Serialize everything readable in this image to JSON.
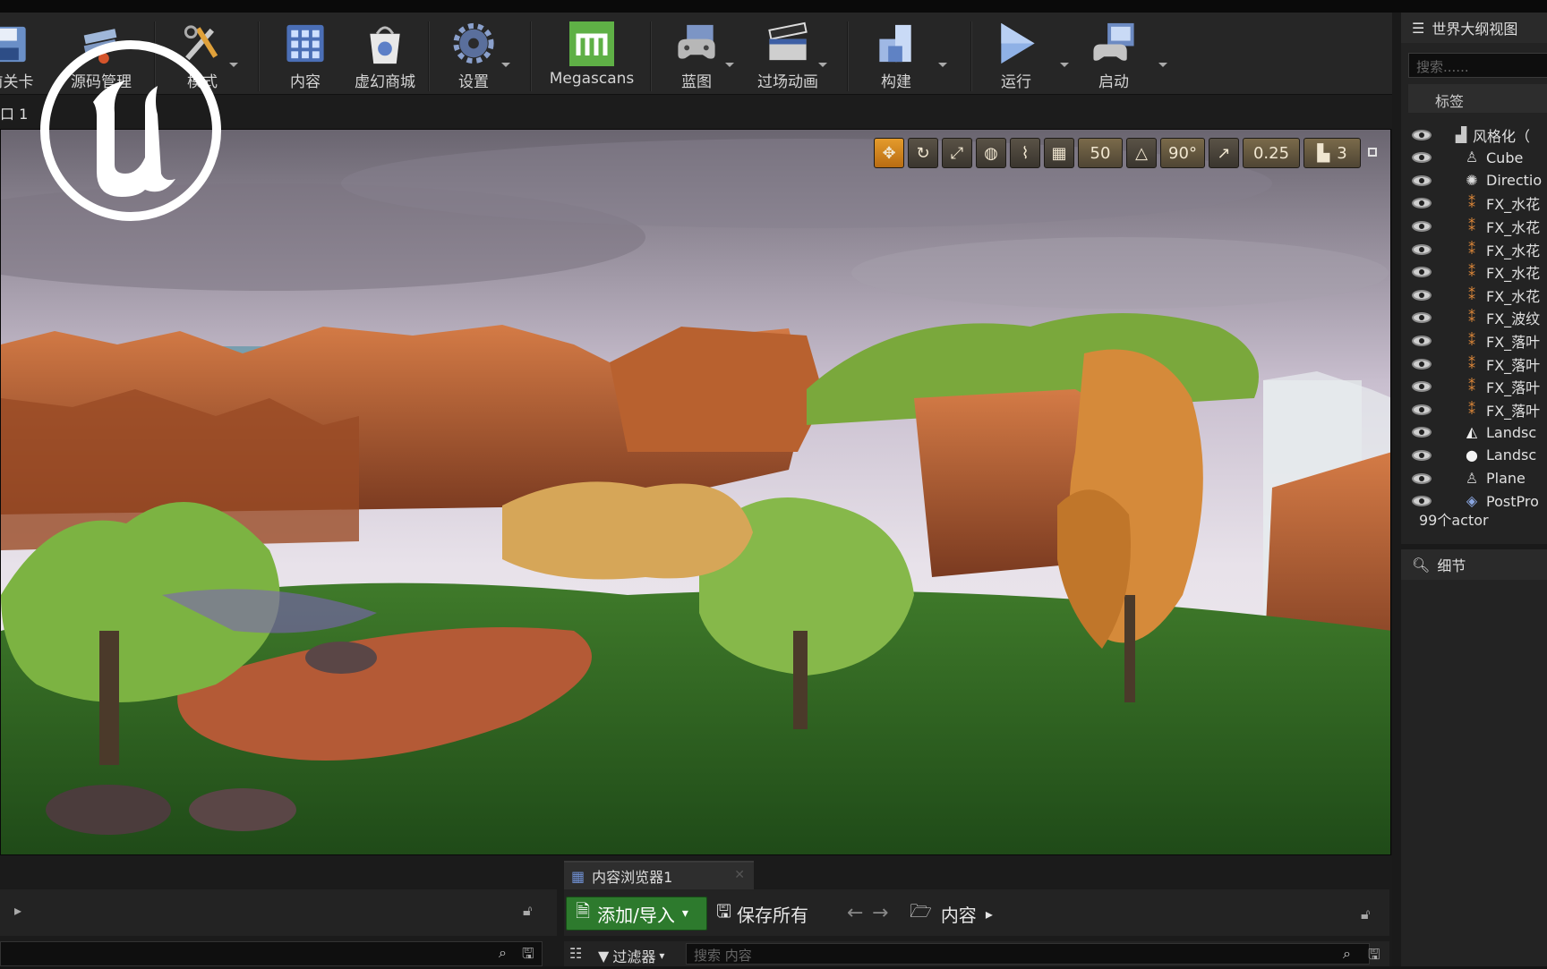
{
  "toolbar": {
    "items": [
      {
        "label": "前关卡",
        "icon": "save-icon"
      },
      {
        "label": "源码管理",
        "icon": "source-control-icon"
      },
      {
        "label": "模式",
        "icon": "modes-icon"
      },
      {
        "label": "内容",
        "icon": "content-icon"
      },
      {
        "label": "虚幻商城",
        "icon": "marketplace-icon"
      },
      {
        "label": "设置",
        "icon": "settings-icon"
      },
      {
        "label": "Megascans",
        "icon": "megascans-icon"
      },
      {
        "label": "蓝图",
        "icon": "blueprint-icon"
      },
      {
        "label": "过场动画",
        "icon": "cinematics-icon"
      },
      {
        "label": "构建",
        "icon": "build-icon"
      },
      {
        "label": "运行",
        "icon": "play-icon"
      },
      {
        "label": "启动",
        "icon": "launch-icon"
      }
    ]
  },
  "viewport": {
    "tab_label": "口 1",
    "grid_snap": "50",
    "rotation_snap": "90°",
    "scale_snap": "0.25",
    "camera_speed": "3"
  },
  "outliner": {
    "title": "世界大纲视图",
    "search_placeholder": "搜索......",
    "column_label": "标签",
    "rows": [
      {
        "label": "风格化（",
        "icon": "folder-icon"
      },
      {
        "label": "Cube",
        "icon": "static-mesh-icon"
      },
      {
        "label": "Directio",
        "icon": "light-icon"
      },
      {
        "label": "FX_水花",
        "icon": "particle-icon"
      },
      {
        "label": "FX_水花",
        "icon": "particle-icon"
      },
      {
        "label": "FX_水花",
        "icon": "particle-icon"
      },
      {
        "label": "FX_水花",
        "icon": "particle-icon"
      },
      {
        "label": "FX_水花",
        "icon": "particle-icon"
      },
      {
        "label": "FX_波纹",
        "icon": "particle-icon"
      },
      {
        "label": "FX_落叶",
        "icon": "particle-icon"
      },
      {
        "label": "FX_落叶",
        "icon": "particle-icon"
      },
      {
        "label": "FX_落叶",
        "icon": "particle-icon"
      },
      {
        "label": "FX_落叶",
        "icon": "particle-icon"
      },
      {
        "label": "Landsc",
        "icon": "landscape-icon"
      },
      {
        "label": "Landsc",
        "icon": "sphere-icon"
      },
      {
        "label": "Plane",
        "icon": "static-mesh-icon"
      },
      {
        "label": "PostPro",
        "icon": "postprocess-icon"
      }
    ],
    "count": "99个actor"
  },
  "details": {
    "title": "细节"
  },
  "content_browser": {
    "tab_label": "内容浏览器1",
    "add_import": "添加/导入",
    "save_all": "保存所有",
    "path_root": "内容",
    "filters_label": "过滤器",
    "search_placeholder": "搜索 内容"
  }
}
